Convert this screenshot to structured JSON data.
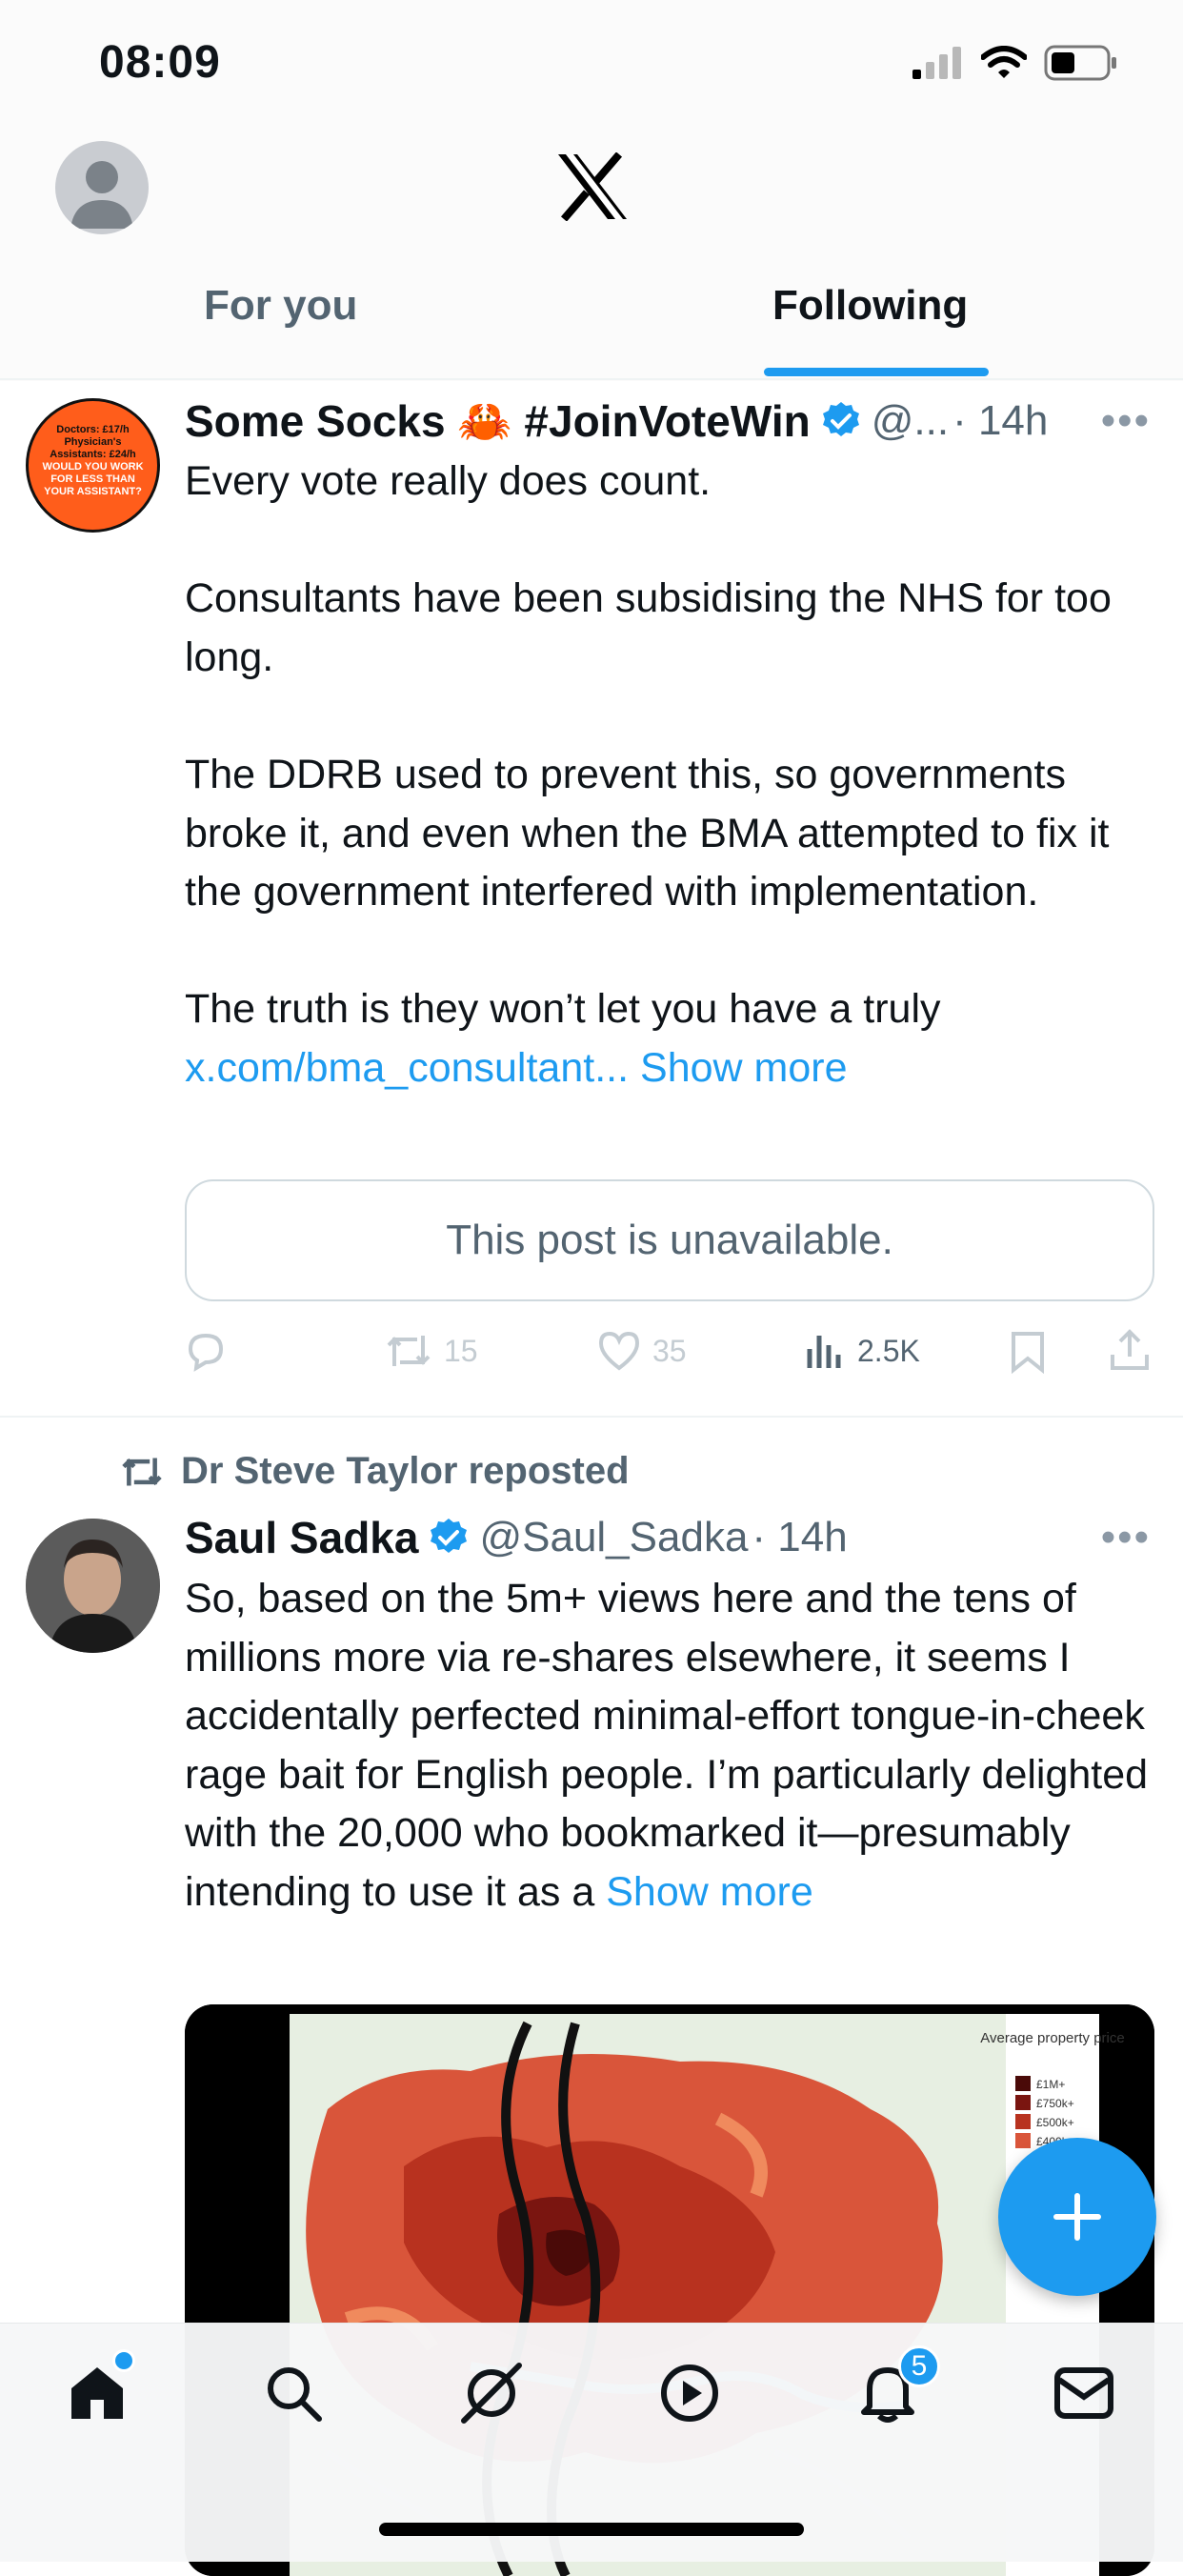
{
  "status_bar": {
    "time": "08:09"
  },
  "tabs": [
    {
      "label": "For you",
      "selected": false
    },
    {
      "label": "Following",
      "selected": true
    }
  ],
  "post1": {
    "avatar_text": [
      "Doctors: £17/h",
      "Physician's",
      "Assistants: £24/h",
      "WOULD YOU WORK",
      "FOR LESS THAN",
      "YOUR ASSISTANT?"
    ],
    "name": "Some Socks 🦀 #JoinVoteWin",
    "handle": "@...",
    "time": "· 14h",
    "body": "Every vote really does count.\n\nConsultants have been subsidising the NHS for too long.\n\nThe DDRB used to prevent this, so governments broke it, and even when the BMA attempted to fix it the government interfered with implementation.\n\nThe truth is they won’t let you have a truly",
    "link": "x.com/bma_consultant...",
    "show_more": "Show more",
    "quote_unavailable": "This post is unavailable.",
    "retweets": "15",
    "likes": "35",
    "views": "2.5K"
  },
  "post2": {
    "reposted_by": "Dr Steve Taylor reposted",
    "name": "Saul Sadka",
    "handle": "@Saul_Sadka",
    "time": "· 14h",
    "body": "So, based on the 5m+ views here and the tens of millions more via re-shares elsewhere, it seems I accidentally perfected minimal-effort tongue-in-cheek rage bait for English people. I’m particularly delighted with the 20,000 who bookmarked it—presumably intending to use it as a ",
    "show_more": "Show more",
    "map_legend": {
      "title": "Average property price",
      "items": [
        "£1M+",
        "£750k+",
        "£500k+",
        "£400k+"
      ]
    }
  },
  "notifications_badge": "5",
  "colors": {
    "accent": "#1d9bf0",
    "text": "#0f1419",
    "secondary": "#536471"
  }
}
